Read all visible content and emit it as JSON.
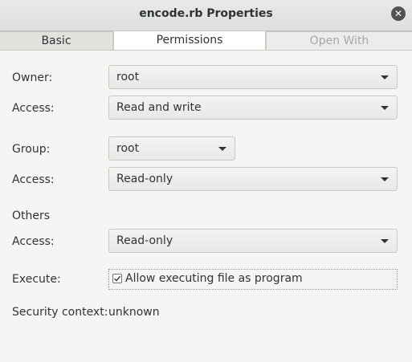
{
  "window": {
    "title": "encode.rb Properties"
  },
  "tabs": [
    {
      "label": "Basic",
      "active": false
    },
    {
      "label": "Permissions",
      "active": true
    },
    {
      "label": "Open With",
      "active": false
    }
  ],
  "owner": {
    "label": "Owner:",
    "value": "root",
    "access_label": "Access:",
    "access_value": "Read and write"
  },
  "group": {
    "label": "Group:",
    "value": "root",
    "access_label": "Access:",
    "access_value": "Read-only"
  },
  "others": {
    "heading": "Others",
    "access_label": "Access:",
    "access_value": "Read-only"
  },
  "execute": {
    "label": "Execute:",
    "checkbox_label": "Allow executing file as program",
    "checked": true
  },
  "security": {
    "label": "Security context:",
    "value": "unknown"
  },
  "icons": {
    "close": "close-icon",
    "dropdown": "chevron-down-icon",
    "check": "check-icon"
  }
}
